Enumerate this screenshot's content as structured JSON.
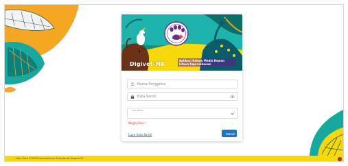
{
  "app": {
    "brand": "Digivet-MK",
    "tagline": "Aplikasi Rekam Medis Hewan Istana Kepresidenan"
  },
  "login": {
    "username_placeholder": "Nama Pengguna",
    "password_placeholder": "Kata Sandi",
    "unit_label": "Unit Kerja",
    "unit_value": "",
    "required_hint": "Wajib Diisi !",
    "forgot_link": "Lupa Kata Sandi",
    "submit_label": "Masuk"
  },
  "footer": {
    "copyright": "Hak Cipta ©2023 Kementerian Sekretariat Negara RI"
  },
  "colors": {
    "accent": "#1976c8",
    "footer_bg": "#f6d80b",
    "leaf_teal": "#17a9a0",
    "leaf_orange": "#f5a623",
    "hint_red": "#e53935"
  }
}
